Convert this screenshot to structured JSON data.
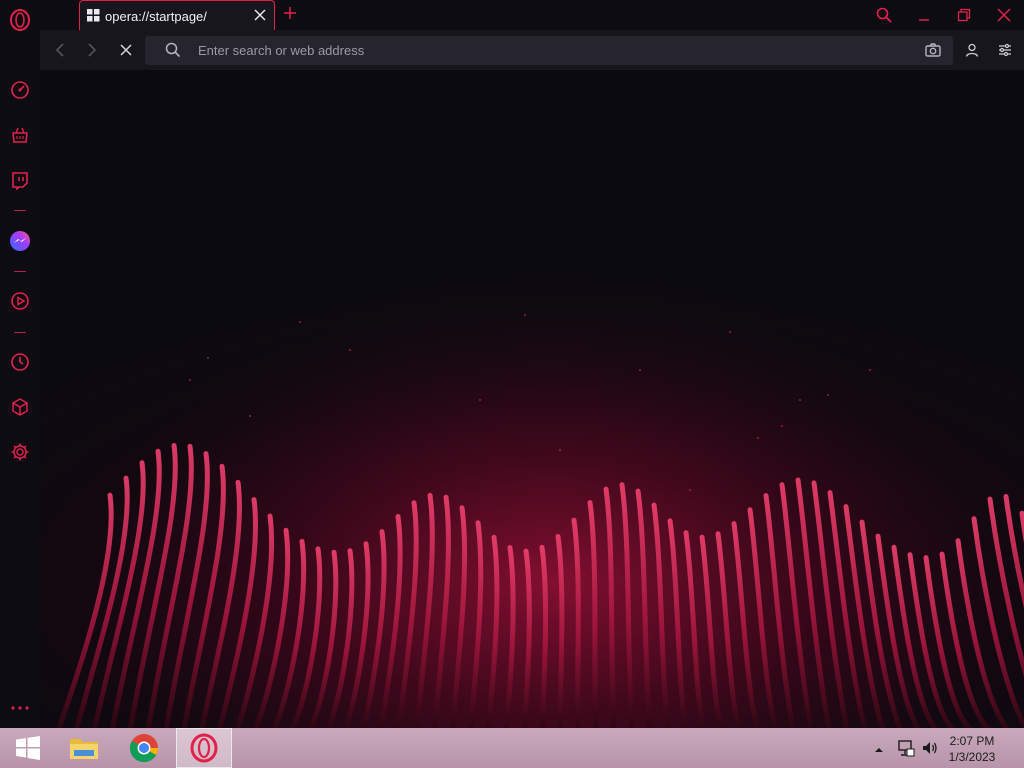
{
  "colors": {
    "accent": "#e0224a",
    "background": "#0b0a10",
    "taskbar": "#c2a0b4"
  },
  "tab": {
    "label": "opera://startpage/",
    "icon": "speed-dial-grid-icon"
  },
  "toolbar": {
    "address_placeholder": "Enter search or web address",
    "back_icon": "back-arrow-icon",
    "forward_icon": "forward-arrow-icon",
    "stop_icon": "stop-x-icon",
    "search_icon": "search-icon",
    "snapshot_icon": "camera-icon",
    "account_icon": "account-icon",
    "settings_icon": "easy-setup-icon"
  },
  "window_controls": [
    "search-tabs-icon",
    "minimize-icon",
    "restore-icon",
    "close-icon"
  ],
  "sidebar": {
    "items": [
      {
        "name": "opera-logo-icon"
      },
      {
        "name": "speed-dial-icon"
      },
      {
        "name": "shopping-icon"
      },
      {
        "name": "twitch-icon"
      },
      {
        "name": "messenger-icon"
      },
      {
        "name": "player-icon"
      },
      {
        "name": "history-icon"
      },
      {
        "name": "extensions-cube-icon"
      },
      {
        "name": "settings-gear-icon"
      },
      {
        "name": "more-dots-icon"
      }
    ]
  },
  "taskbar": {
    "apps": [
      "windows-start-icon",
      "file-explorer-icon",
      "chrome-icon",
      "opera-icon"
    ],
    "tray": [
      "show-hidden-icons-icon",
      "network-icon",
      "volume-icon"
    ],
    "time": "2:07 PM",
    "date": "1/3/2023"
  }
}
